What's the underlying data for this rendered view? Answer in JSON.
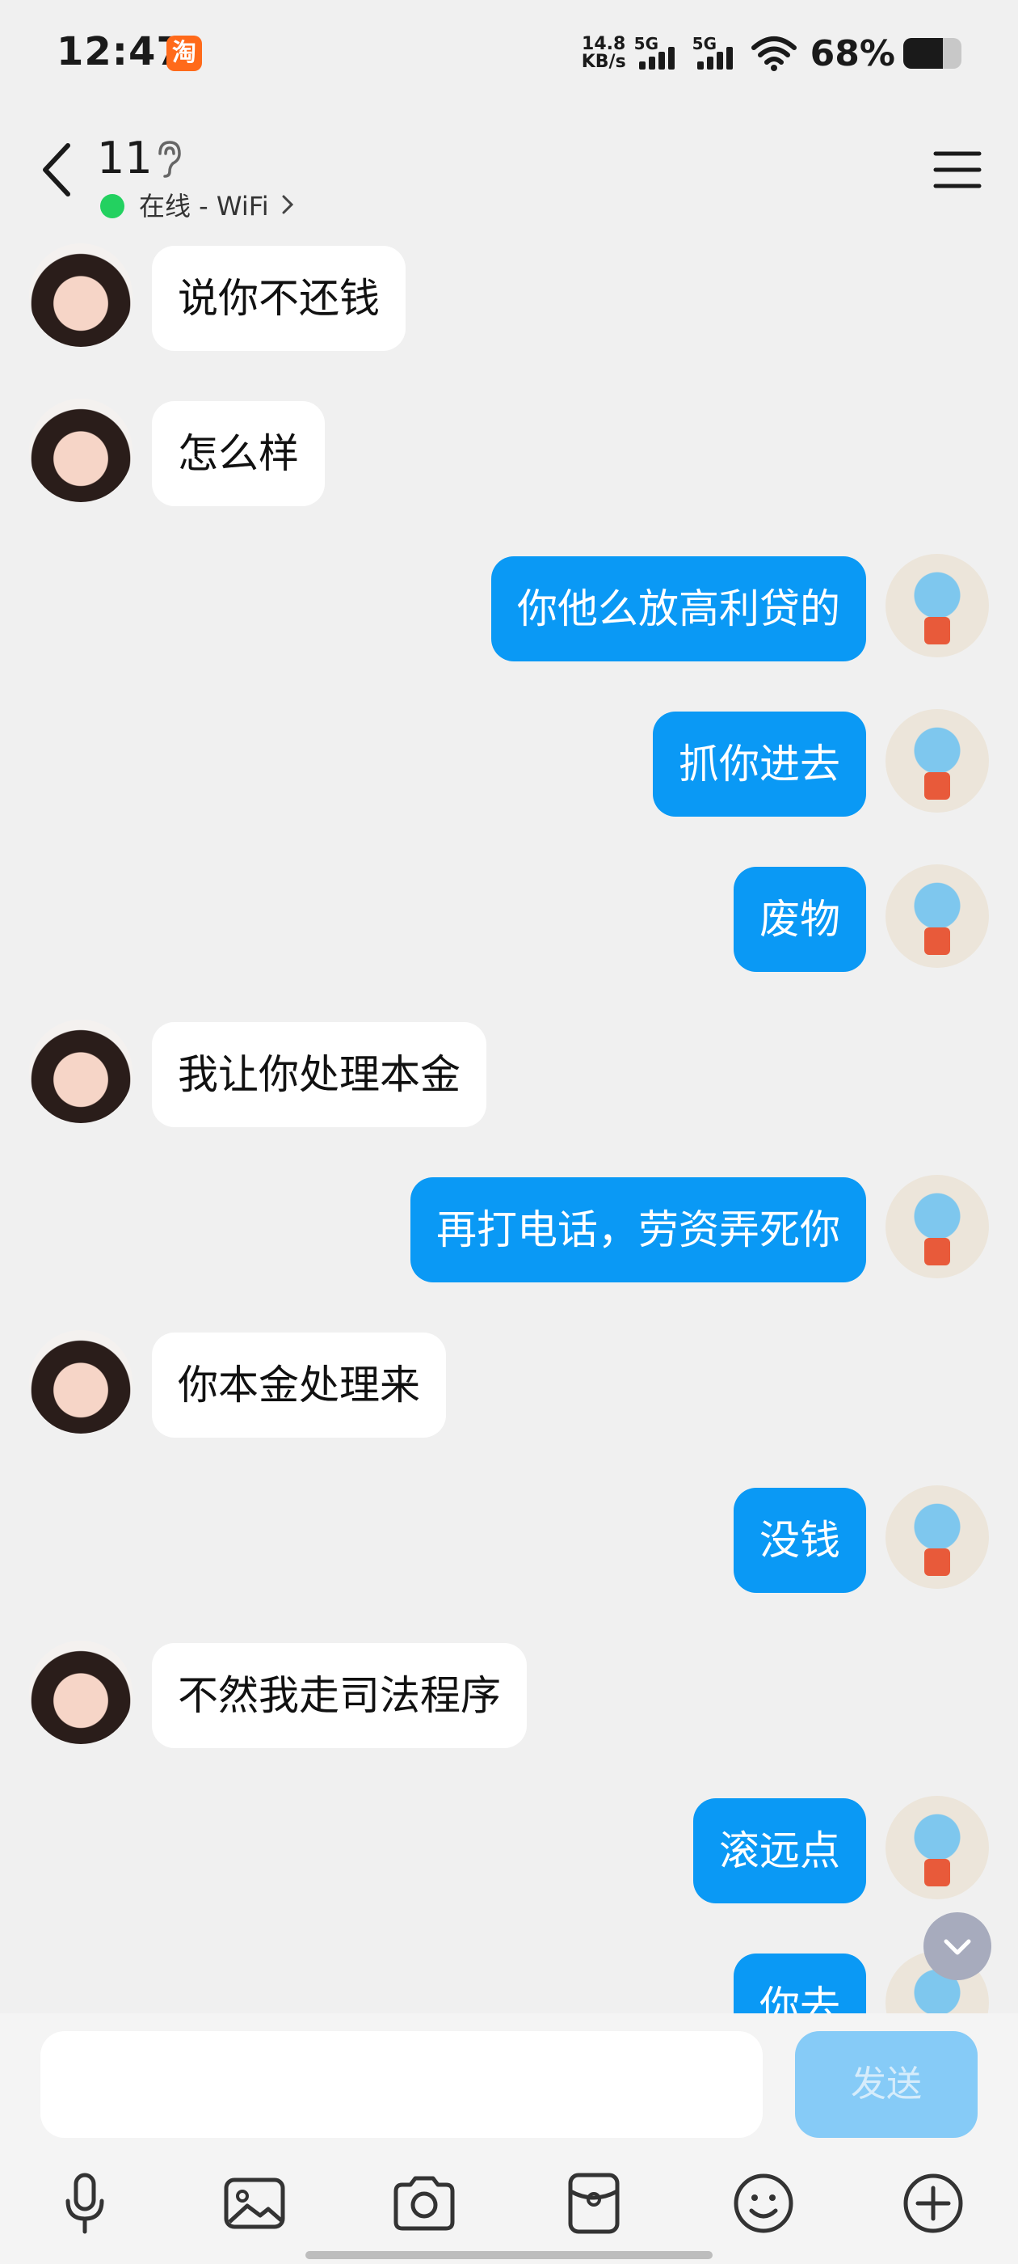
{
  "status_bar": {
    "time": "12:47",
    "app_icon_char": "淘",
    "speed_value": "14.8",
    "speed_unit": "KB/s",
    "sim1_net": "5G",
    "sim2_net": "5G",
    "battery_text": "68%",
    "battery_level": 0.68
  },
  "header": {
    "title": "11",
    "online_status": "在线 - WiFi"
  },
  "messages": [
    {
      "side": "left",
      "text": "说你不还钱"
    },
    {
      "side": "left",
      "text": "怎么样"
    },
    {
      "side": "right",
      "text": "你他么放高利贷的"
    },
    {
      "side": "right",
      "text": "抓你进去"
    },
    {
      "side": "right",
      "text": "废物"
    },
    {
      "side": "left",
      "text": "我让你处理本金"
    },
    {
      "side": "right",
      "text": "再打电话，劳资弄死你"
    },
    {
      "side": "left",
      "text": "你本金处理来"
    },
    {
      "side": "right",
      "text": "没钱"
    },
    {
      "side": "left",
      "text": "不然我走司法程序"
    },
    {
      "side": "right",
      "text": "滚远点"
    },
    {
      "side": "right",
      "text": "你去"
    }
  ],
  "input": {
    "value": "",
    "send_label": "发送"
  },
  "toolbar": {
    "icons": [
      "microphone-icon",
      "image-icon",
      "camera-icon",
      "red-packet-icon",
      "emoji-icon",
      "plus-icon"
    ]
  },
  "colors": {
    "accent": "#0a99f5",
    "online": "#23d160",
    "send_disabled": "#86cbf7"
  }
}
